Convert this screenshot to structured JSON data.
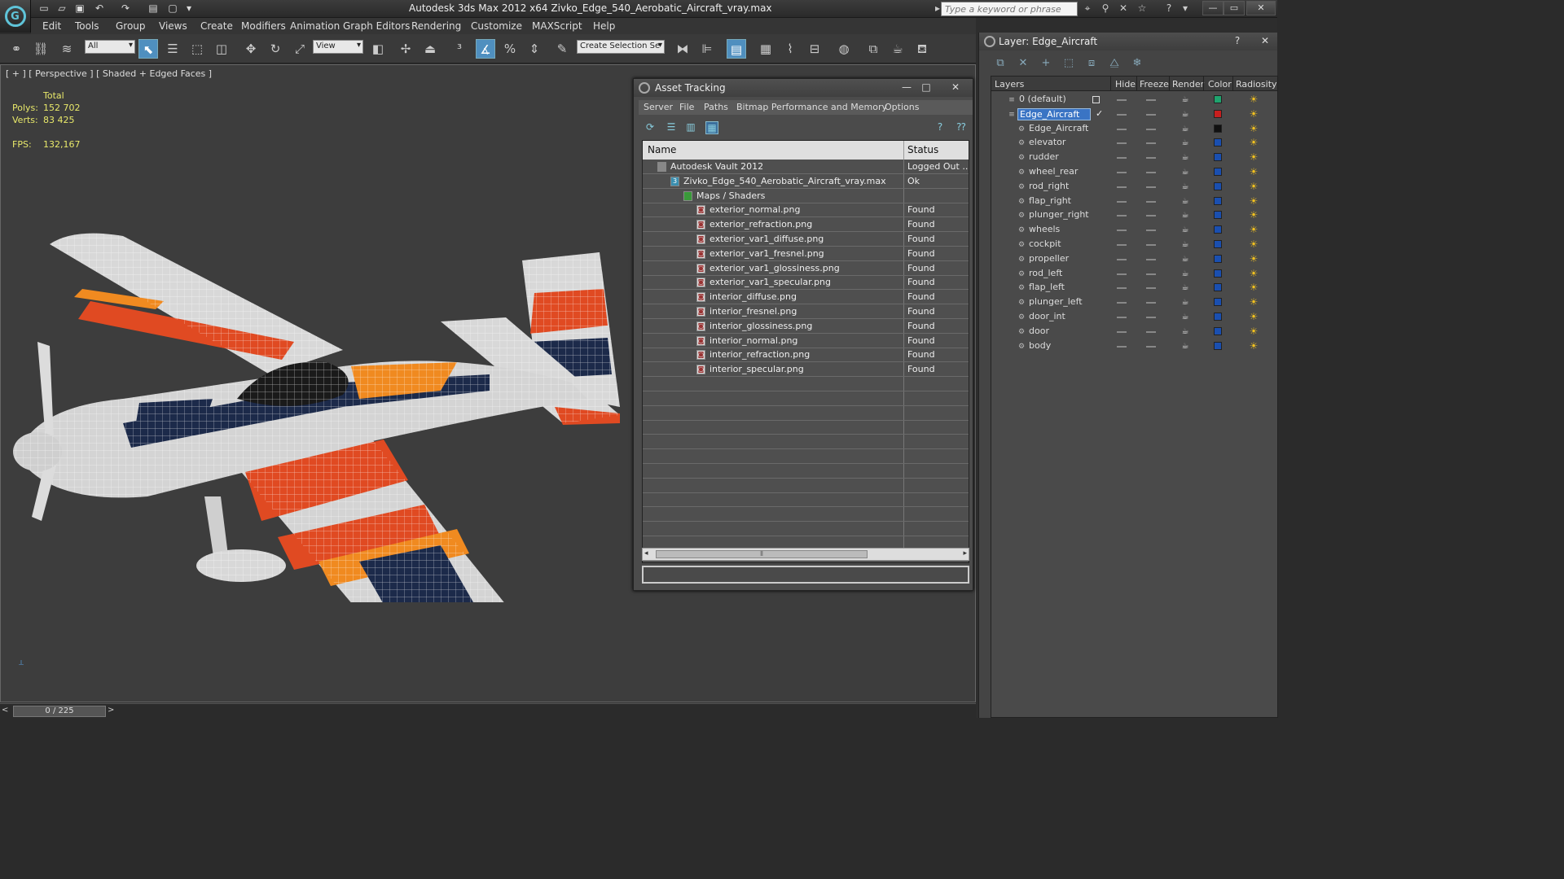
{
  "titlebar": {
    "title": "Autodesk 3ds Max  2012 x64     Zivko_Edge_540_Aerobatic_Aircraft_vray.max",
    "search_placeholder": "Type a keyword or phrase"
  },
  "menu": [
    "Edit",
    "Tools",
    "Group",
    "Views",
    "Create",
    "Modifiers",
    "Animation",
    "Graph Editors",
    "Rendering",
    "Customize",
    "MAXScript",
    "Help"
  ],
  "toolbar": {
    "filter_value": "All",
    "ref_coord_value": "View",
    "selection_set_value": "Create Selection Se"
  },
  "viewport": {
    "label": "[ + ] [ Perspective ] [ Shaded + Edged Faces ]",
    "stats": {
      "total_label": "Total",
      "polys_label": "Polys:",
      "polys_value": "152 702",
      "verts_label": "Verts:",
      "verts_value": "83 425",
      "fps_label": "FPS:",
      "fps_value": "132,167"
    }
  },
  "timeslider": {
    "value": "0 / 225"
  },
  "asset_tracking": {
    "title": "Asset Tracking",
    "menu": [
      "Server",
      "File",
      "Paths",
      "Bitmap Performance and Memory",
      "Options"
    ],
    "headers": {
      "name": "Name",
      "status": "Status"
    },
    "rows": [
      {
        "name": "Autodesk Vault 2012",
        "status": "Logged Out ...",
        "level": 0
      },
      {
        "name": "Zivko_Edge_540_Aerobatic_Aircraft_vray.max",
        "status": "Ok",
        "level": 1
      },
      {
        "name": "Maps / Shaders",
        "status": "",
        "level": 2
      },
      {
        "name": "exterior_normal.png",
        "status": "Found",
        "level": 3
      },
      {
        "name": "exterior_refraction.png",
        "status": "Found",
        "level": 3
      },
      {
        "name": "exterior_var1_diffuse.png",
        "status": "Found",
        "level": 3
      },
      {
        "name": "exterior_var1_fresnel.png",
        "status": "Found",
        "level": 3
      },
      {
        "name": "exterior_var1_glossiness.png",
        "status": "Found",
        "level": 3
      },
      {
        "name": "exterior_var1_specular.png",
        "status": "Found",
        "level": 3
      },
      {
        "name": "interior_diffuse.png",
        "status": "Found",
        "level": 3
      },
      {
        "name": "interior_fresnel.png",
        "status": "Found",
        "level": 3
      },
      {
        "name": "interior_glossiness.png",
        "status": "Found",
        "level": 3
      },
      {
        "name": "interior_normal.png",
        "status": "Found",
        "level": 3
      },
      {
        "name": "interior_refraction.png",
        "status": "Found",
        "level": 3
      },
      {
        "name": "interior_specular.png",
        "status": "Found",
        "level": 3
      }
    ]
  },
  "layer": {
    "title": "Layer: Edge_Aircraft",
    "headers": [
      "Layers",
      "Hide",
      "Freeze",
      "Render",
      "Color",
      "Radiosity"
    ],
    "rows": [
      {
        "name": "0 (default)",
        "type": "layer",
        "color": "#1fa36e"
      },
      {
        "name": "Edge_Aircraft",
        "type": "layer-active",
        "color": "#c81e1e"
      },
      {
        "name": "Edge_Aircraft",
        "type": "object",
        "color": "#111111"
      },
      {
        "name": "elevator",
        "type": "object",
        "color": "#1a4fb0"
      },
      {
        "name": "rudder",
        "type": "object",
        "color": "#1a4fb0"
      },
      {
        "name": "wheel_rear",
        "type": "object",
        "color": "#1a4fb0"
      },
      {
        "name": "rod_right",
        "type": "object",
        "color": "#1a4fb0"
      },
      {
        "name": "flap_right",
        "type": "object",
        "color": "#1a4fb0"
      },
      {
        "name": "plunger_right",
        "type": "object",
        "color": "#1a4fb0"
      },
      {
        "name": "wheels",
        "type": "object",
        "color": "#1a4fb0"
      },
      {
        "name": "cockpit",
        "type": "object",
        "color": "#1a4fb0"
      },
      {
        "name": "propeller",
        "type": "object",
        "color": "#1a4fb0"
      },
      {
        "name": "rod_left",
        "type": "object",
        "color": "#1a4fb0"
      },
      {
        "name": "flap_left",
        "type": "object",
        "color": "#1a4fb0"
      },
      {
        "name": "plunger_left",
        "type": "object",
        "color": "#1a4fb0"
      },
      {
        "name": "door_int",
        "type": "object",
        "color": "#1a4fb0"
      },
      {
        "name": "door",
        "type": "object",
        "color": "#1a4fb0"
      },
      {
        "name": "body",
        "type": "object",
        "color": "#1a4fb0"
      }
    ]
  }
}
